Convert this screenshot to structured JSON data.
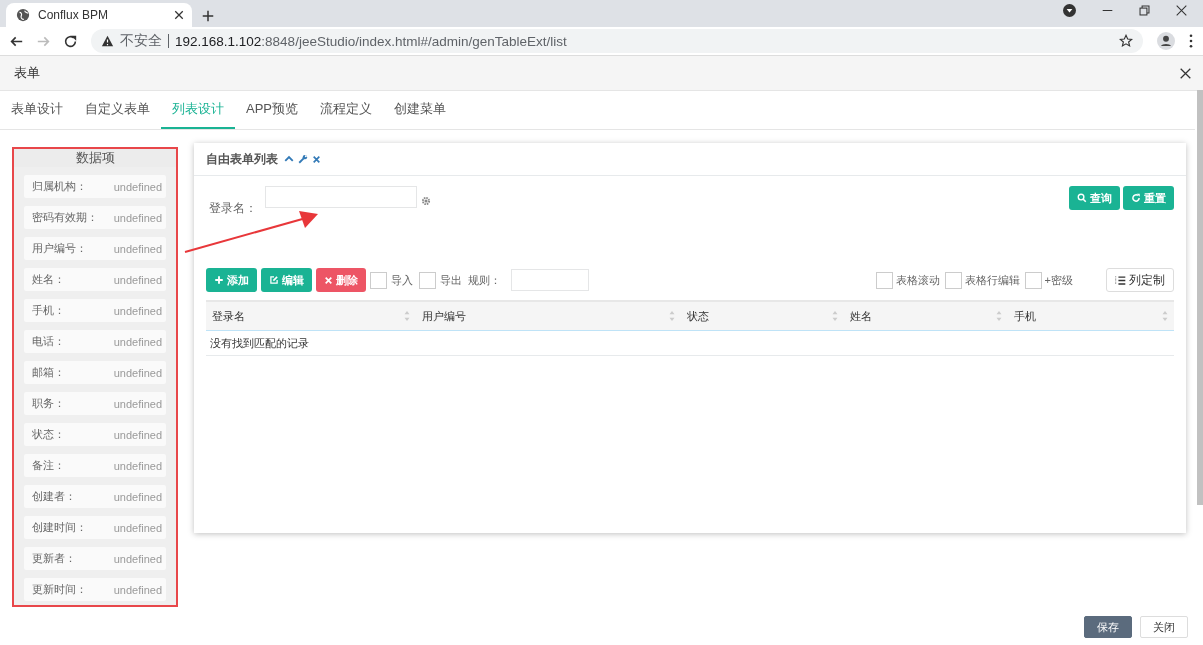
{
  "browser": {
    "tab_title": "Conflux BPM",
    "security": "不安全",
    "url_host": "192.168.1.102",
    "url_path": ":8848/jeeStudio/index.html#/admin/genTableExt/list"
  },
  "modal": {
    "title": "表单"
  },
  "tabs": [
    {
      "label": "表单设计",
      "selected": false
    },
    {
      "label": "自定义表单",
      "selected": false
    },
    {
      "label": "列表设计",
      "selected": true
    },
    {
      "label": "APP预览",
      "selected": false
    },
    {
      "label": "流程定义",
      "selected": false
    },
    {
      "label": "创建菜单",
      "selected": false
    }
  ],
  "data_panel": {
    "title": "数据项",
    "items": [
      {
        "label": "归属机构：",
        "value": "undefined"
      },
      {
        "label": "密码有效期：",
        "value": "undefined"
      },
      {
        "label": "用户编号：",
        "value": "undefined"
      },
      {
        "label": "姓名：",
        "value": "undefined"
      },
      {
        "label": "手机：",
        "value": "undefined"
      },
      {
        "label": "电话：",
        "value": "undefined"
      },
      {
        "label": "邮箱：",
        "value": "undefined"
      },
      {
        "label": "职务：",
        "value": "undefined"
      },
      {
        "label": "状态：",
        "value": "undefined"
      },
      {
        "label": "备注：",
        "value": "undefined"
      },
      {
        "label": "创建者：",
        "value": "undefined"
      },
      {
        "label": "创建时间：",
        "value": "undefined"
      },
      {
        "label": "更新者：",
        "value": "undefined"
      },
      {
        "label": "更新时间：",
        "value": "undefined"
      }
    ]
  },
  "card": {
    "title": "自由表单列表",
    "search": {
      "label": "登录名："
    },
    "search_buttons": [
      {
        "kind": "search",
        "label": "查询"
      },
      {
        "kind": "reset",
        "label": "重置"
      }
    ],
    "toolbar": {
      "buttons": [
        {
          "kind": "add",
          "label": "添加"
        },
        {
          "kind": "edit",
          "label": "编辑"
        },
        {
          "kind": "delete",
          "label": "删除"
        }
      ],
      "left_checks": [
        {
          "label": "导入",
          "checked": false
        },
        {
          "label": "导出",
          "checked": false
        }
      ],
      "rule_label": "规则：",
      "right_checks": [
        {
          "label": "表格滚动",
          "checked": false
        },
        {
          "label": "表格行编辑",
          "checked": false
        },
        {
          "label": "+密级",
          "checked": false
        }
      ],
      "columns_button": "列定制"
    },
    "table": {
      "columns": [
        "登录名",
        "用户编号",
        "状态",
        "姓名",
        "手机"
      ],
      "empty_text": "没有找到匹配的记录"
    }
  },
  "footer": {
    "buttons": [
      {
        "kind": "primary",
        "label": "保存"
      },
      {
        "kind": "default",
        "label": "关闭"
      }
    ]
  }
}
